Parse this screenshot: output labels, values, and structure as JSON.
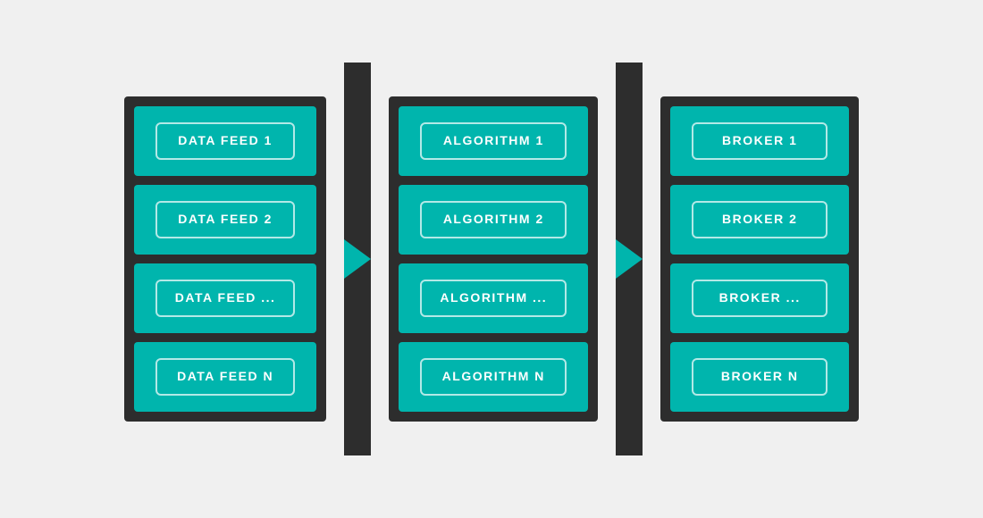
{
  "diagram": {
    "columns": [
      {
        "id": "data-feeds",
        "cards": [
          {
            "label": "DATA FEED 1"
          },
          {
            "label": "DATA FEED 2"
          },
          {
            "label": "DATA FEED ..."
          },
          {
            "label": "DATA FEED N"
          }
        ]
      },
      {
        "id": "algorithms",
        "cards": [
          {
            "label": "ALGORITHM 1"
          },
          {
            "label": "ALGORITHM 2"
          },
          {
            "label": "ALGORITHM ..."
          },
          {
            "label": "ALGORITHM N"
          }
        ]
      },
      {
        "id": "brokers",
        "cards": [
          {
            "label": "BROKER 1"
          },
          {
            "label": "BROKER 2"
          },
          {
            "label": "BROKER ..."
          },
          {
            "label": "BROKER N"
          }
        ]
      }
    ],
    "connectors": [
      {
        "id": "connector-1"
      },
      {
        "id": "connector-2"
      }
    ]
  }
}
